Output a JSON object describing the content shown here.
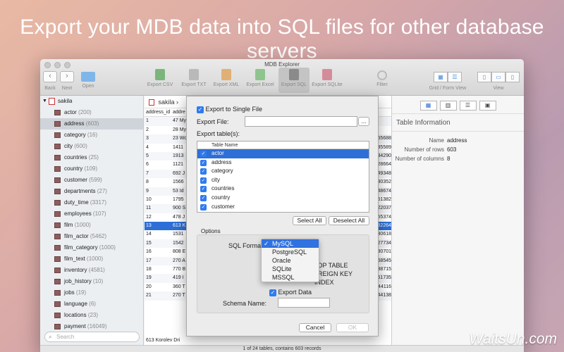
{
  "headline": "Export your MDB data into SQL files for other database servers",
  "window": {
    "title": "MDB Explorer",
    "toolbar": {
      "back": "Back",
      "forward": "Next",
      "open": "Open",
      "export_csv": "Export CSV",
      "export_txt": "Export TXT",
      "export_xml": "Export XML",
      "export_excel": "Export Excel",
      "export_sql": "Export SQL",
      "export_sqlite": "Export SQLite",
      "filter": "Filter",
      "grid_form": "Grid / Form View",
      "view": "View",
      "prev_glyph": "‹",
      "next_glyph": "›"
    }
  },
  "sidebar": {
    "database": "sakila",
    "items": [
      {
        "name": "actor",
        "count": "(200)"
      },
      {
        "name": "address",
        "count": "(603)"
      },
      {
        "name": "category",
        "count": "(16)"
      },
      {
        "name": "city",
        "count": "(600)"
      },
      {
        "name": "countries",
        "count": "(25)"
      },
      {
        "name": "country",
        "count": "(109)"
      },
      {
        "name": "customer",
        "count": "(599)"
      },
      {
        "name": "departments",
        "count": "(27)"
      },
      {
        "name": "duty_time",
        "count": "(3317)"
      },
      {
        "name": "employees",
        "count": "(107)"
      },
      {
        "name": "film",
        "count": "(1000)"
      },
      {
        "name": "film_actor",
        "count": "(5462)"
      },
      {
        "name": "film_category",
        "count": "(1000)"
      },
      {
        "name": "film_text",
        "count": "(1000)"
      },
      {
        "name": "inventory",
        "count": "(4581)"
      },
      {
        "name": "job_history",
        "count": "(10)"
      },
      {
        "name": "jobs",
        "count": "(19)"
      },
      {
        "name": "language",
        "count": "(6)"
      },
      {
        "name": "locations",
        "count": "(23)"
      },
      {
        "name": "payment",
        "count": "(16049)"
      }
    ],
    "selected_index": 1,
    "search_placeholder": "Search"
  },
  "grid": {
    "breadcrumb": "sakila",
    "header": {
      "c1": "address_id",
      "c2": "addre"
    },
    "rows": [
      {
        "c1": "1",
        "c2": "47 My",
        "c3": ""
      },
      {
        "c1": "2",
        "c2": "28 My",
        "c3": ""
      },
      {
        "c1": "3",
        "c2": "23 Wo",
        "c3": "55688"
      },
      {
        "c1": "4",
        "c2": "1411",
        "c3": "35589"
      },
      {
        "c1": "5",
        "c2": "1913",
        "c3": "34290"
      },
      {
        "c1": "6",
        "c2": "1121",
        "c3": "28664"
      },
      {
        "c1": "7",
        "c2": "692 J",
        "c3": "49348"
      },
      {
        "c1": "8",
        "c2": "1566",
        "c3": "30352"
      },
      {
        "c1": "9",
        "c2": "53 Id",
        "c3": "48674"
      },
      {
        "c1": "10",
        "c2": "1795",
        "c3": "61382"
      },
      {
        "c1": "11",
        "c2": "900 S",
        "c3": "22037"
      },
      {
        "c1": "12",
        "c2": "478 J",
        "c3": "55374"
      },
      {
        "c1": "13",
        "c2": "613 K",
        "c3": "82264"
      },
      {
        "c1": "14",
        "c2": "1531",
        "c3": "30618"
      },
      {
        "c1": "15",
        "c2": "1542",
        "c3": "27734"
      },
      {
        "c1": "16",
        "c2": "808 E",
        "c3": "30701"
      },
      {
        "c1": "17",
        "c2": "270 A",
        "c3": "68545"
      },
      {
        "c1": "18",
        "c2": "770 B",
        "c3": "38715"
      },
      {
        "c1": "19",
        "c2": "419 I",
        "c3": "51735"
      },
      {
        "c1": "20",
        "c2": "360 T",
        "c3": "44116"
      },
      {
        "c1": "21",
        "c2": "270 T",
        "c3": "44138"
      }
    ],
    "selected_index": 12,
    "footer_cell": "613 Korolev Dri"
  },
  "info": {
    "title": "Table Information",
    "name_label": "Name",
    "name_value": "address",
    "rows_label": "Number of rows",
    "rows_value": "603",
    "cols_label": "Number of columns",
    "cols_value": "8"
  },
  "status": "1 of 24 tables, contains 603 records",
  "dialog": {
    "export_single": "Export to Single File",
    "export_file_label": "Export File:",
    "export_file_value": "",
    "browse": "...",
    "export_tables_label": "Export table(s):",
    "table_header": "Table Name",
    "tables": [
      "actor",
      "address",
      "category",
      "city",
      "countries",
      "country",
      "customer"
    ],
    "selected_table": 0,
    "select_all": "Select All",
    "deselect_all": "Deselect All",
    "options_label": "Options",
    "sql_format_label": "SQL Format",
    "partial_options": [
      "re",
      "ROP TABLE",
      "OREIGN KEY",
      "INDEX"
    ],
    "export_data": "Export Data",
    "schema_label": "Schema Name:",
    "schema_value": "",
    "cancel": "Cancel",
    "ok": "OK",
    "check_glyph": "✓"
  },
  "format_menu": {
    "options": [
      "MySQL",
      "PostgreSQL",
      "Oracle",
      "SQLite",
      "MSSQL"
    ],
    "selected": 0
  },
  "watermark": "WaitsUn.com",
  "colors": {
    "accent": "#2d6fd6",
    "check": "#2f7bf0"
  }
}
